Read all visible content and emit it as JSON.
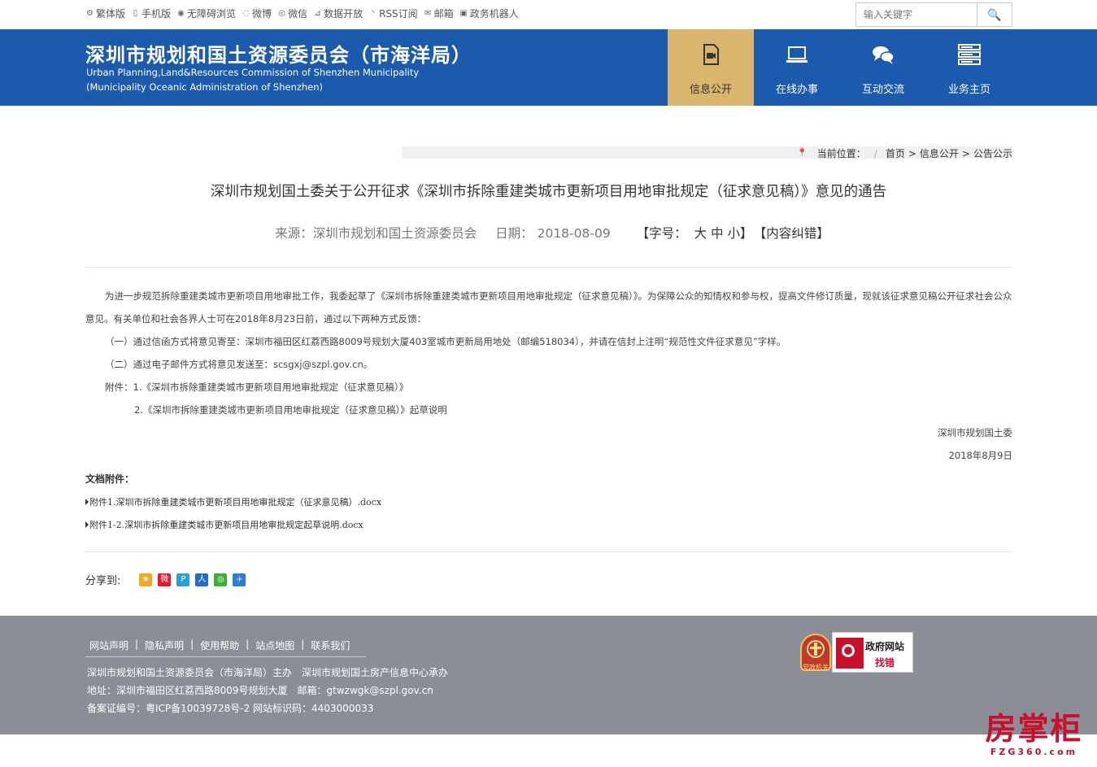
{
  "topbar": {
    "links": [
      {
        "icon": "gear-icon",
        "glyph": "⚙",
        "label": "繁体版"
      },
      {
        "icon": "mobile-icon",
        "glyph": "▯",
        "label": "手机版"
      },
      {
        "icon": "eye-icon",
        "glyph": "◉",
        "label": "无障碍浏览"
      },
      {
        "icon": "weibo-icon",
        "glyph": "◌",
        "label": "微博"
      },
      {
        "icon": "wechat-icon",
        "glyph": "◎",
        "label": "微信"
      },
      {
        "icon": "chart-icon",
        "glyph": "⊿",
        "label": "数据开放"
      },
      {
        "icon": "rss-icon",
        "glyph": "◝",
        "label": "RSS订阅"
      },
      {
        "icon": "mail-icon",
        "glyph": "✉",
        "label": "邮箱"
      },
      {
        "icon": "robot-icon",
        "glyph": "▣",
        "label": "政务机器人"
      }
    ],
    "search_placeholder": "输入关键字",
    "search_button": "🔍"
  },
  "header": {
    "title_cn": "深圳市规划和国土资源委员会（市海洋局）",
    "title_en_1": "Urban Planning,Land&Resources Commission of Shenzhen Municipality",
    "title_en_2": "(Municipality Oceanic Administration of Shenzhen)",
    "nav": [
      {
        "label": "信息公开",
        "icon": "document-video-icon",
        "active": true
      },
      {
        "label": "在线办事",
        "icon": "laptop-icon",
        "active": false
      },
      {
        "label": "互动交流",
        "icon": "chat-icon",
        "active": false
      },
      {
        "label": "业务主页",
        "icon": "server-icon",
        "active": false
      }
    ]
  },
  "breadcrumb": {
    "prefix": "当前位置：",
    "items": [
      "首页",
      "信息公开",
      "公告公示"
    ],
    "sep": ">"
  },
  "article": {
    "title": "深圳市规划国土委关于公开征求《深圳市拆除重建类城市更新项目用地审批规定（征求意见稿）》意见的通告",
    "source": "来源：深圳市规划和国土资源委员会",
    "date": "日期： 2018-08-09",
    "font_size_label": "【字号：",
    "font_sizes": "大 中 小",
    "font_size_end": "】",
    "report_error": "【内容纠错】",
    "paragraph1": "为进一步规范拆除重建类城市更新项目用地审批工作，我委起草了《深圳市拆除重建类城市更新项目用地审批规定（征求意见稿）》。为保障公众的知情权和参与权，提高文件修订质量，现就该征求意见稿公开征求社会公众意见。有关单位和社会各界人士可在2018年8月23日前，通过以下两种方式反馈：",
    "way1": "（一）通过信函方式将意见寄至：深圳市福田区红荔西路8009号规划大厦403室城市更新局用地处（邮编518034），并请在信封上注明“规范性文件征求意见”字样。",
    "way2": "（二）通过电子邮件方式将意见发送至：scsgxj@szpl.gov.cn。",
    "attach_line1": "附件：1.《深圳市拆除重建类城市更新项目用地审批规定（征求意见稿）》",
    "attach_line2": "2.《深圳市拆除重建类城市更新项目用地审批规定（征求意见稿）》起草说明",
    "signature": "深圳市规划国土委",
    "sign_date": "2018年8月9日",
    "attachments_title": "文档附件：",
    "files": [
      "附件1.深圳市拆除重建类城市更新项目用地审批规定（征求意见稿）.docx",
      "附件1-2.深圳市拆除重建类城市更新项目用地审批规定起草说明.docx"
    ],
    "share_label": "分享到:"
  },
  "share_icons": [
    {
      "name": "qzone-icon",
      "color": "#f5a623",
      "glyph": "★"
    },
    {
      "name": "weibo-share-icon",
      "color": "#e6162d",
      "glyph": "微"
    },
    {
      "name": "tencent-weibo-icon",
      "color": "#2c9fd8",
      "glyph": "P"
    },
    {
      "name": "renren-icon",
      "color": "#1f6fc4",
      "glyph": "人"
    },
    {
      "name": "wechat-share-icon",
      "color": "#3cb034",
      "glyph": "◎"
    },
    {
      "name": "more-share-icon",
      "color": "#2a7fd4",
      "glyph": "+"
    }
  ],
  "footer": {
    "links": [
      "网站声明",
      "隐私声明",
      "使用帮助",
      "站点地图",
      "联系我们"
    ],
    "sep": "|",
    "line1": "深圳市规划和国土资源委员会（市海洋局）主办　深圳市规划国土房产信息中心承办",
    "line2": "地址：深圳市福田区红荔西路8009号规划大厦　邮箱：gtwzwgk@szpl.gov.cn",
    "line3": "备案证编号：粤ICP备10039728号-2 网站标识码：4403000033",
    "badge1": "党政机关",
    "badge2_line1": "政府网站",
    "badge2_line2": "找错"
  },
  "watermark": {
    "big": "房掌柜",
    "small": "FZG360.com"
  }
}
